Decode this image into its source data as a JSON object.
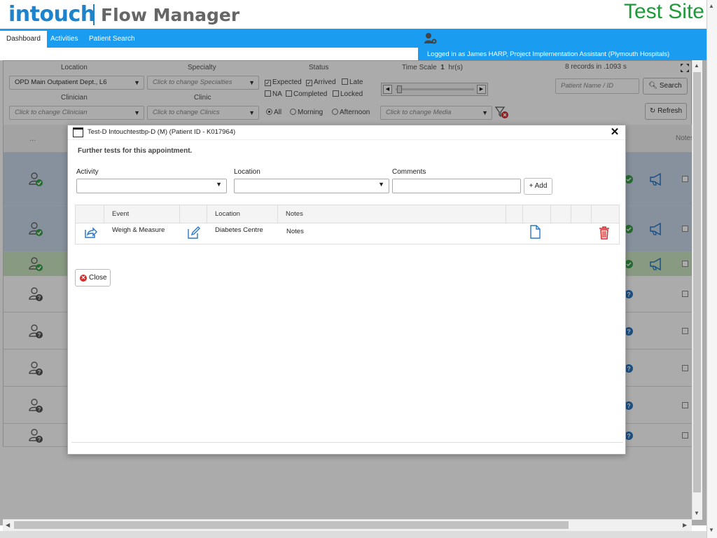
{
  "header": {
    "brand": "intouch",
    "product": "Flow Manager",
    "site": "Test Site"
  },
  "nav": {
    "tabs": [
      "Dashboard",
      "Activities",
      "Patient Search"
    ],
    "active": "Dashboard"
  },
  "user_bar": {
    "text": "Logged in as James HARP, Project Implementation Assistant (Plymouth Hospitals)"
  },
  "filters": {
    "location_label": "Location",
    "location_value": "OPD Main Outpatient Dept., L6",
    "specialty_label": "Specialty",
    "specialty_placeholder": "Click to change Specialties",
    "clinician_label": "Clinician",
    "clinician_placeholder": "Click to change Clinician",
    "clinic_label": "Clinic",
    "clinic_placeholder": "Click to change Clinics",
    "status_label": "Status",
    "status_options": [
      {
        "label": "Expected",
        "checked": true
      },
      {
        "label": "Arrived",
        "checked": true
      },
      {
        "label": "Late",
        "checked": false
      },
      {
        "label": "NA",
        "checked": false
      },
      {
        "label": "Completed",
        "checked": false
      },
      {
        "label": "Locked",
        "checked": false
      }
    ],
    "session_options": [
      "All",
      "Morning",
      "Afternoon"
    ],
    "session_selected": "All",
    "timescale_label": "Time Scale",
    "timescale_value": "1",
    "timescale_unit": "hr(s)",
    "media_placeholder": "Click to change Media",
    "records": "8 records in .1093 s",
    "patient_placeholder": "Patient Name / ID",
    "search_label": "Search",
    "refresh_label": "Refresh"
  },
  "grid": {
    "header_dots": "...",
    "notes_header": "Notes",
    "rows": [
      {
        "bg": "#c9d8ec",
        "state": "arrived"
      },
      {
        "bg": "#c9d8ec",
        "state": "arrived"
      },
      {
        "bg": "#cde6c3",
        "state": "arrived"
      },
      {
        "bg": "#ffffff",
        "state": "expected"
      },
      {
        "bg": "#ffffff",
        "state": "expected"
      },
      {
        "bg": "#ffffff",
        "state": "expected"
      },
      {
        "bg": "#ffffff",
        "state": "expected"
      },
      {
        "bg": "#ffffff",
        "state": "expected"
      }
    ]
  },
  "modal": {
    "title": "Test-D Intouchtestbp-D (M) (Patient ID - K017964)",
    "subtitle": "Further tests for this appointment.",
    "activity_label": "Activity",
    "location_label": "Location",
    "comments_label": "Comments",
    "add_label": "Add",
    "table": {
      "headers": [
        "Event",
        "Location",
        "Notes"
      ],
      "rows": [
        {
          "event": "Weigh & Measure",
          "location": "Diabetes Centre",
          "notes": "Notes"
        }
      ]
    },
    "close_label": "Close"
  },
  "colors": {
    "brand": "#1f83cc",
    "nav": "#1a9cf0",
    "site": "#1f9a3a",
    "delete": "#d32a2a"
  }
}
